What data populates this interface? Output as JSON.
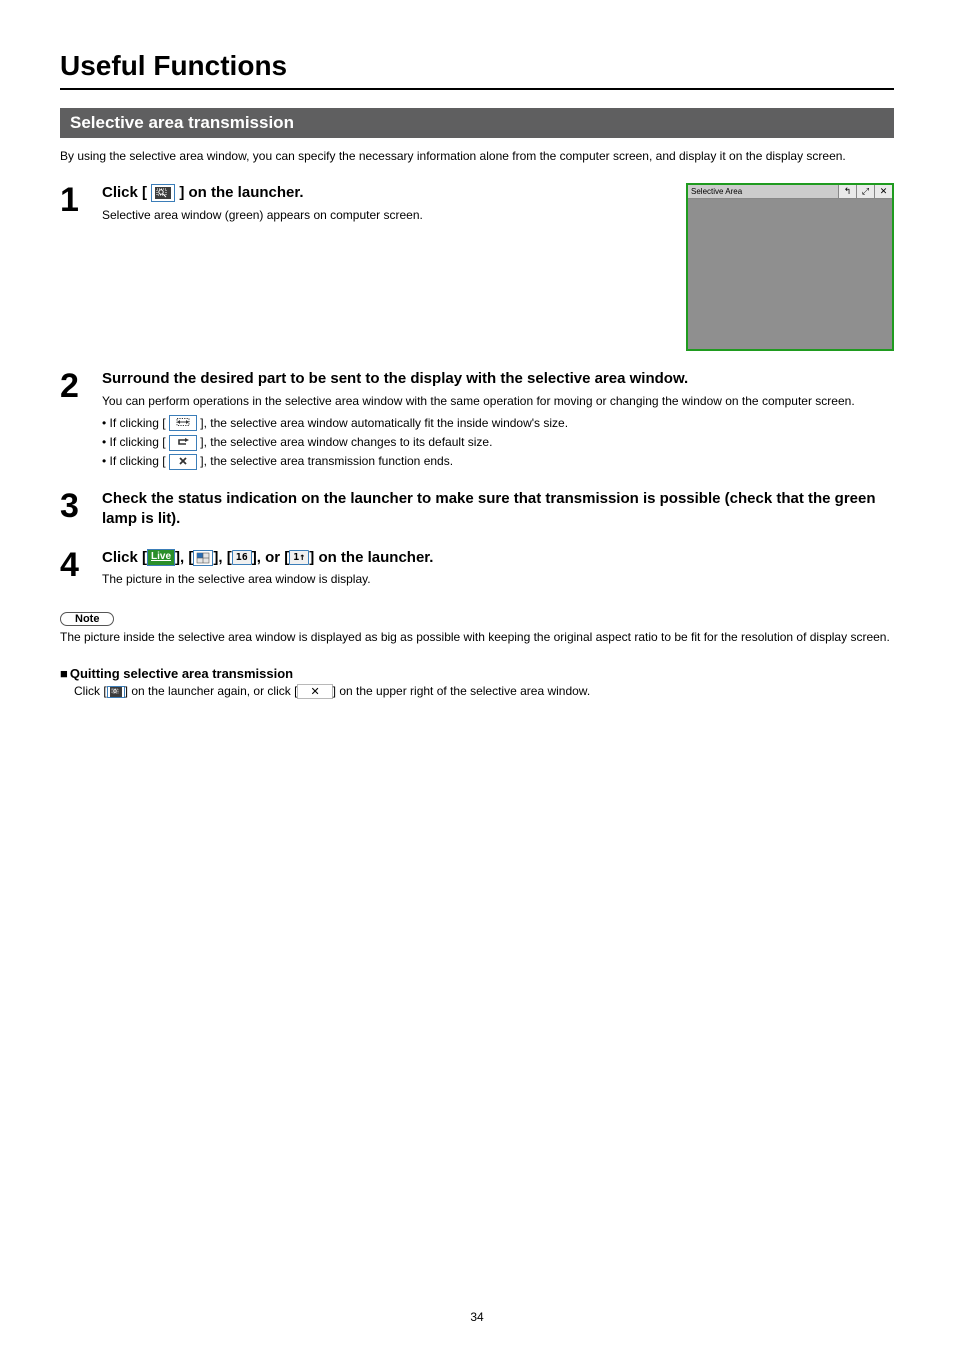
{
  "page_title": "Useful Functions",
  "section_title": "Selective area transmission",
  "intro": "By using the selective area window, you can specify the necessary information alone from the computer screen, and display it on the display screen.",
  "steps": {
    "s1": {
      "num": "1",
      "heading_a": "Click [",
      "heading_b": "] on the launcher.",
      "sub": "Selective area window (green) appears on computer screen."
    },
    "s2": {
      "num": "2",
      "heading": "Surround the desired part to be sent to the display with the selective area window.",
      "sub": "You can perform operations in the selective area window with the same operation for moving or changing the window on the computer screen.",
      "b1_a": "• If clicking [",
      "b1_b": "], the selective area window automatically fit the inside window's size.",
      "b2_a": "• If clicking [",
      "b2_b": "], the selective area window changes to its default size.",
      "b3_a": "• If clicking [",
      "b3_b": "], the selective area transmission function ends."
    },
    "s3": {
      "num": "3",
      "heading": "Check the status indication on the launcher to make sure that transmission is possible (check that the green lamp is lit)."
    },
    "s4": {
      "num": "4",
      "heading_a": "Click [",
      "heading_b": "], [",
      "heading_c": "], [",
      "heading_d": "], or [",
      "heading_e": "] on the launcher.",
      "sub": "The picture in the selective area window is display."
    }
  },
  "note_label": "Note",
  "note_text": "The picture inside the selective area window is displayed as big as possible with keeping the original aspect ratio to be fit for the resolution of display screen.",
  "quit": {
    "heading": "Quitting selective area transmission",
    "body_a": "Click [",
    "body_b": "] on the launcher again, or click [",
    "body_c": "] on the upper right of the selective area window."
  },
  "screenshot": {
    "title": "Selective Area",
    "btn_revert": "↰",
    "btn_fit": "⤢",
    "btn_close": "✕"
  },
  "icons": {
    "live": "Live",
    "four": "4",
    "sixteen": "16",
    "onearrow": "1↑",
    "close": "✕"
  },
  "page_number": "34"
}
